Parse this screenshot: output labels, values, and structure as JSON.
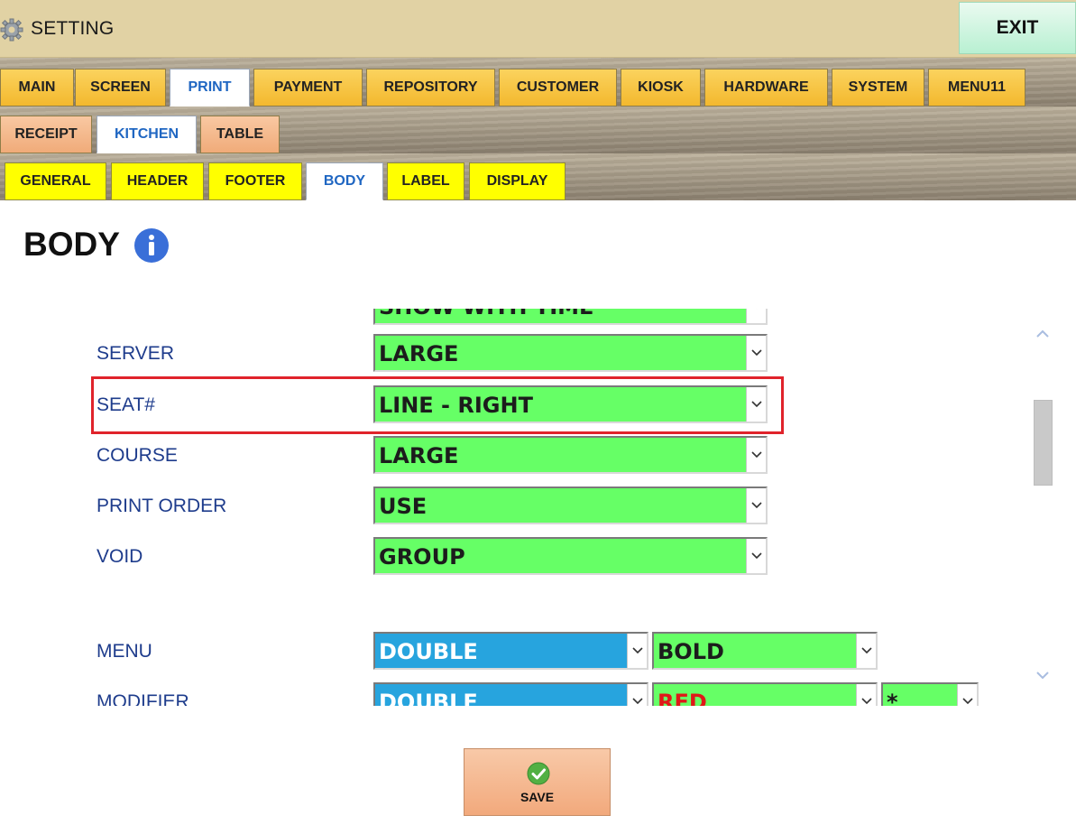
{
  "window": {
    "title": "SETTING",
    "exit_label": "EXIT"
  },
  "tabs_main": [
    "MAIN",
    "SCREEN",
    "PRINT",
    "PAYMENT",
    "REPOSITORY",
    "CUSTOMER",
    "KIOSK",
    "HARDWARE",
    "SYSTEM",
    "MENU11"
  ],
  "tabs_main_active": "PRINT",
  "tabs_print": [
    "RECEIPT",
    "KITCHEN",
    "TABLE"
  ],
  "tabs_print_active": "KITCHEN",
  "tabs_kitchen": [
    "GENERAL",
    "HEADER",
    "FOOTER",
    "BODY",
    "LABEL",
    "DISPLAY"
  ],
  "tabs_kitchen_active": "BODY",
  "page": {
    "title": "BODY"
  },
  "form": {
    "partial_top_value": "SHOW WITH TIME",
    "server": {
      "label": "SERVER",
      "value": "LARGE"
    },
    "seat": {
      "label": "SEAT#",
      "value": "LINE - RIGHT"
    },
    "course": {
      "label": "COURSE",
      "value": "LARGE"
    },
    "print_order": {
      "label": "PRINT ORDER",
      "value": "USE"
    },
    "void": {
      "label": "VOID",
      "value": "GROUP"
    },
    "menu": {
      "label": "MENU",
      "size": "DOUBLE",
      "style": "BOLD"
    },
    "modifier": {
      "label": "MODIFIER",
      "size": "DOUBLE",
      "color": "RED",
      "prefix": "*"
    }
  },
  "save_label": "SAVE",
  "colors": {
    "select_green": "#66ff66",
    "select_blue": "#27a4de",
    "label_blue": "#1e3c8c",
    "highlight_red": "#e0232b",
    "tab_yellow": "#ffff00",
    "tab_gold": "#f3b82e",
    "tab_peach": "#f0ab79"
  },
  "icons": {
    "title": "gear-icon",
    "info": "info-icon",
    "save": "check-circle-icon",
    "dropdown": "chevron-down-icon"
  }
}
